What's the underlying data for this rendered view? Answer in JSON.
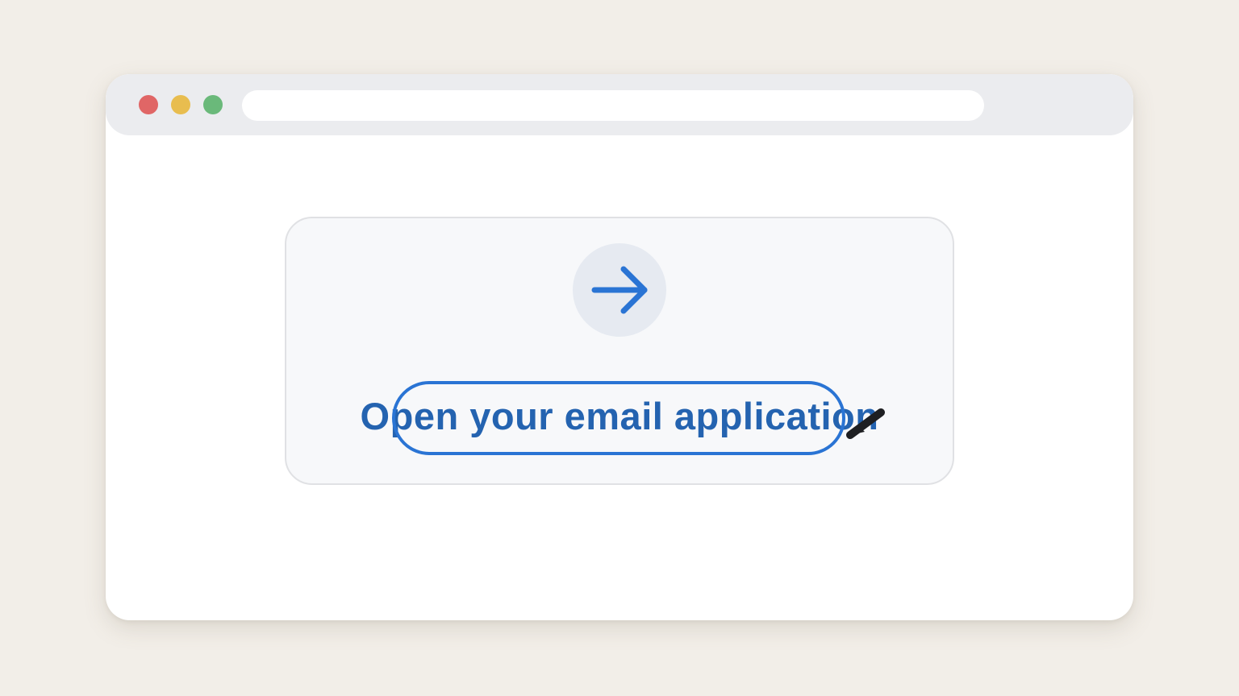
{
  "window": {
    "controls": [
      {
        "name": "close",
        "color": "#e06666"
      },
      {
        "name": "minimize",
        "color": "#e8bd4f"
      },
      {
        "name": "maximize",
        "color": "#6ab97a"
      }
    ],
    "address_bar": {
      "value": ""
    }
  },
  "card": {
    "icon": "arrow-right-icon",
    "icon_color": "#2a74d4",
    "action_text": "Open your email application",
    "text_color": "#2463b0",
    "highlight_color": "#2a74d4"
  },
  "cursor": {
    "icon": "pen-cursor-icon"
  }
}
